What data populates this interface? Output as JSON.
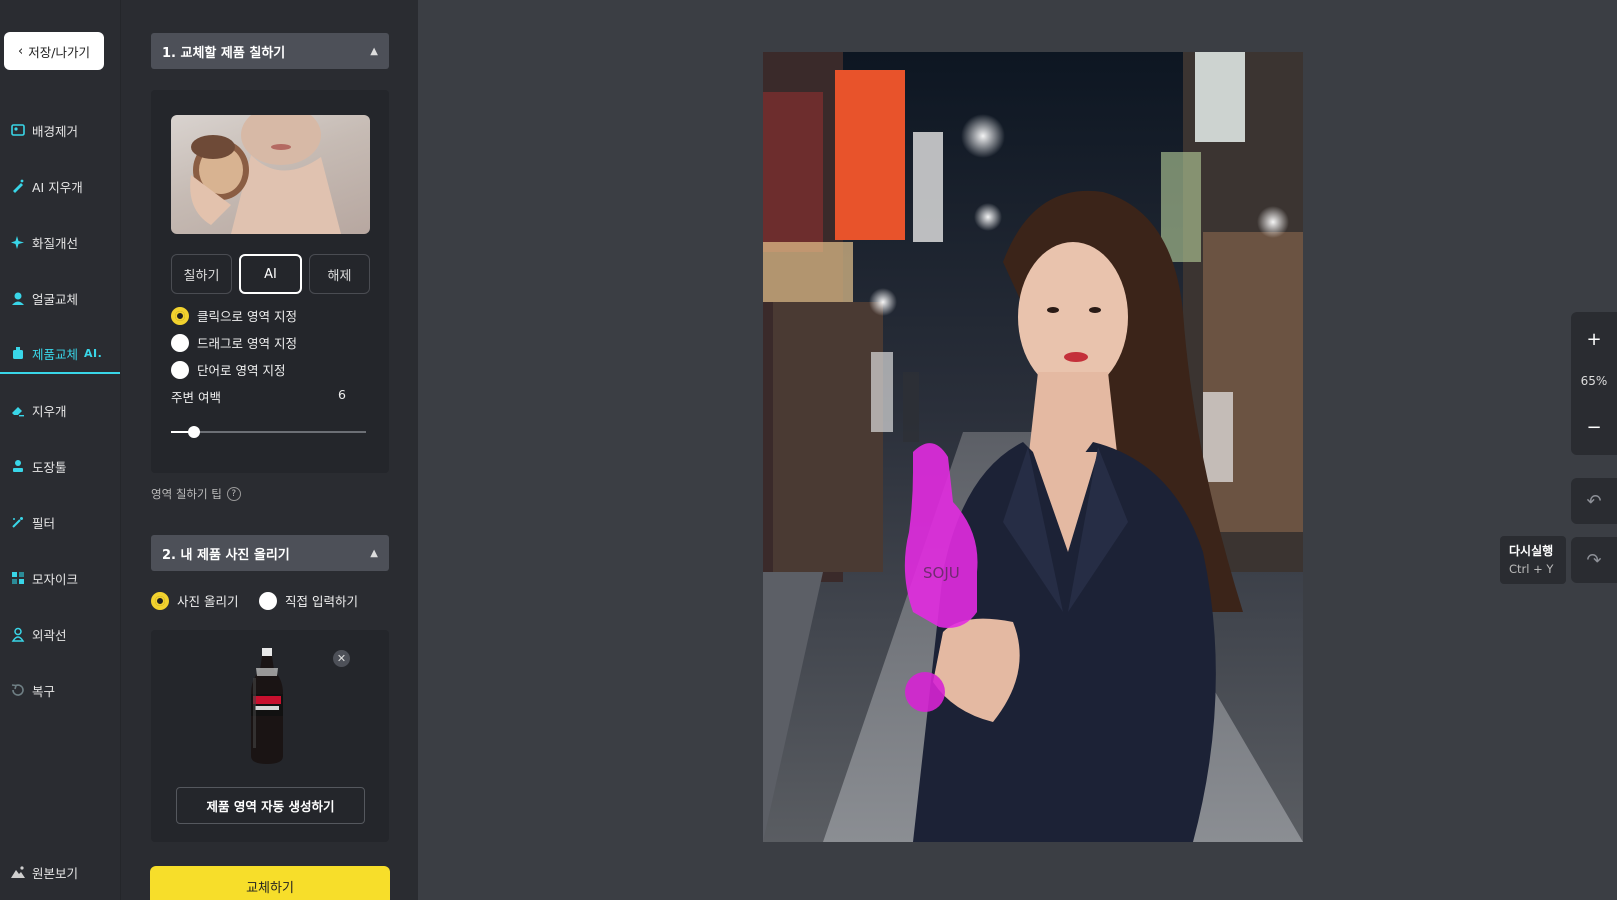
{
  "nav": {
    "back_label": "저장/나가기",
    "items": [
      {
        "label": "배경제거",
        "icon": "background-remove-icon"
      },
      {
        "label": "AI 지우개",
        "icon": "ai-eraser-icon"
      },
      {
        "label": "화질개선",
        "icon": "sparkle-icon"
      },
      {
        "label": "얼굴교체",
        "icon": "face-swap-icon"
      },
      {
        "label": "제품교체",
        "tag": "AI.",
        "icon": "product-swap-icon",
        "active": true
      },
      {
        "label": "지우개",
        "icon": "eraser-icon"
      },
      {
        "label": "도장툴",
        "icon": "stamp-icon"
      },
      {
        "label": "필터",
        "icon": "filter-icon"
      },
      {
        "label": "모자이크",
        "icon": "mosaic-icon"
      },
      {
        "label": "외곽선",
        "icon": "outline-icon"
      },
      {
        "label": "복구",
        "icon": "restore-icon"
      }
    ],
    "original_view_label": "원본보기"
  },
  "panel": {
    "section1": {
      "title": "1. 교체할 제품 칠하기",
      "modes": [
        "칠하기",
        "AI",
        "해제"
      ],
      "selected_mode": "AI",
      "options": [
        {
          "label": "클릭으로 영역 지정",
          "checked": true
        },
        {
          "label": "드래그로 영역 지정",
          "checked": false
        },
        {
          "label": "단어로 영역 지정",
          "checked": false
        }
      ],
      "margin_label": "주변 여백",
      "margin_value": "6",
      "margin_fraction": 0.12
    },
    "tip_label": "영역 칠하기 팁",
    "tip_icon": "?",
    "section2": {
      "title": "2. 내 제품 사진 올리기",
      "options": [
        {
          "label": "사진 올리기",
          "checked": true
        },
        {
          "label": "직접 입력하기",
          "checked": false
        }
      ],
      "generate_label": "제품 영역 자동 생성하기"
    },
    "replace_label": "교체하기"
  },
  "canvas": {
    "zoom_in": "+",
    "zoom_value": "65%",
    "zoom_out": "−",
    "tooltip_title": "다시실행",
    "tooltip_shortcut": "Ctrl + Y"
  },
  "colors": {
    "accent": "#39d6e8",
    "primary_button": "#f7de2a",
    "mask": "#e22be0"
  }
}
